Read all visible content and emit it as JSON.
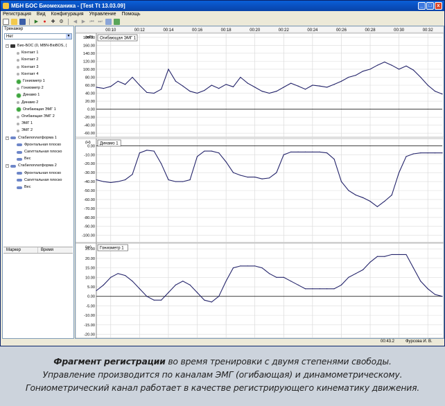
{
  "window": {
    "title": "МБН БОС Биомеханика - [Test Tt  13.03.09]",
    "minimize": "_",
    "maximize": "□",
    "close": "x"
  },
  "menu": [
    "Регистрация",
    "Вид",
    "Конфигурация",
    "Управление",
    "Помощь"
  ],
  "left_panel": {
    "label": "Тренажер",
    "select_value": "Нет",
    "tree": [
      {
        "label": "Био-БОС (0, MBN-BioBOS, (",
        "icon": "device-icon",
        "level": 1,
        "expand": "-"
      },
      {
        "label": "Контакт 1",
        "icon": "channel-inactive-icon",
        "level": 2
      },
      {
        "label": "Контакт 2",
        "icon": "channel-inactive-icon",
        "level": 2
      },
      {
        "label": "Контакт 3",
        "icon": "channel-inactive-icon",
        "level": 2
      },
      {
        "label": "Контакт 4",
        "icon": "channel-inactive-icon",
        "level": 2
      },
      {
        "label": "Гониометр 1",
        "icon": "channel-active-icon",
        "level": 2
      },
      {
        "label": "Гониометр 2",
        "icon": "channel-inactive-icon",
        "level": 2
      },
      {
        "label": "Динамо 1",
        "icon": "channel-active-icon",
        "level": 2
      },
      {
        "label": "Динамо 2",
        "icon": "channel-inactive-icon",
        "level": 2
      },
      {
        "label": "Огибающая ЭМГ 1",
        "icon": "channel-active-icon",
        "level": 2
      },
      {
        "label": "Огибающая ЭМГ 2",
        "icon": "channel-inactive-icon",
        "level": 2
      },
      {
        "label": "ЭМГ 1",
        "icon": "channel-inactive-icon",
        "level": 2
      },
      {
        "label": "ЭМГ 2",
        "icon": "channel-inactive-icon",
        "level": 2
      },
      {
        "label": "Стабилоплатформа 1",
        "icon": "platform-icon",
        "level": 1,
        "expand": "-"
      },
      {
        "label": "Фронтальная плоско",
        "icon": "platform-icon",
        "level": 2
      },
      {
        "label": "Сагиттальная плоско",
        "icon": "platform-icon",
        "level": 2
      },
      {
        "label": "Вес",
        "icon": "platform-icon",
        "level": 2
      },
      {
        "label": "Стабилоплатформа 2",
        "icon": "platform-icon",
        "level": 1,
        "expand": "-"
      },
      {
        "label": "Фронтальная плоско",
        "icon": "platform-icon",
        "level": 2
      },
      {
        "label": "Сагиттальная плоско",
        "icon": "platform-icon",
        "level": 2
      },
      {
        "label": "Вес",
        "icon": "platform-icon",
        "level": 2
      }
    ],
    "grid_columns": [
      "Маркер",
      "Время"
    ]
  },
  "time_axis": [
    "00:10",
    "00:12",
    "00:14",
    "00:16",
    "00:18",
    "00:20",
    "00:22",
    "00:24",
    "00:26",
    "00:28",
    "00:30",
    "00:32"
  ],
  "chart_data": [
    {
      "type": "line",
      "title": "Огибающая ЭМГ 1",
      "unit": "(мВ)",
      "ylim": [
        -70,
        190
      ],
      "yticks": [
        "180.00",
        "160.00",
        "140.00",
        "120.00",
        "100.00",
        "80.00",
        "60.00",
        "40.00",
        "20.00",
        "0.00",
        "-20.00",
        "-40.00",
        "-60.00"
      ],
      "x": [
        9.0,
        9.5,
        10.0,
        10.5,
        11.0,
        11.5,
        12.0,
        12.5,
        13.0,
        13.5,
        14.0,
        14.5,
        15.0,
        15.5,
        16.0,
        16.5,
        17.0,
        17.5,
        18.0,
        18.5,
        19.0,
        19.5,
        20.0,
        20.5,
        21.0,
        21.5,
        22.0,
        22.5,
        23.0,
        23.5,
        24.0,
        24.5,
        25.0,
        25.5,
        26.0,
        26.5,
        27.0,
        27.5,
        28.0,
        28.5,
        29.0,
        29.5,
        30.0,
        30.5,
        31.0,
        31.5,
        32.0,
        32.5,
        33.0
      ],
      "values": [
        55,
        52,
        57,
        70,
        62,
        80,
        60,
        42,
        40,
        50,
        100,
        70,
        58,
        45,
        40,
        47,
        60,
        52,
        62,
        56,
        80,
        65,
        55,
        45,
        40,
        45,
        55,
        65,
        58,
        50,
        60,
        58,
        55,
        62,
        70,
        80,
        85,
        95,
        100,
        110,
        118,
        110,
        100,
        108,
        98,
        80,
        60,
        45,
        38
      ]
    },
    {
      "type": "line",
      "title": "Динамо 1",
      "unit": "(Н)",
      "ylim": [
        -108,
        8
      ],
      "yticks": [
        "0.00",
        "-10.00",
        "-20.00",
        "-30.00",
        "-40.00",
        "-50.00",
        "-60.00",
        "-70.00",
        "-80.00",
        "-90.00",
        "-100.00"
      ],
      "x": [
        9.0,
        9.5,
        10.0,
        10.5,
        11.0,
        11.5,
        12.0,
        12.5,
        13.0,
        13.5,
        14.0,
        14.5,
        15.0,
        15.5,
        16.0,
        16.5,
        17.0,
        17.5,
        18.0,
        18.5,
        19.0,
        19.5,
        20.0,
        20.5,
        21.0,
        21.5,
        22.0,
        22.5,
        23.0,
        23.5,
        24.0,
        24.5,
        25.0,
        25.5,
        26.0,
        26.5,
        27.0,
        27.5,
        28.0,
        28.5,
        29.0,
        29.5,
        30.0,
        30.5,
        31.0,
        31.5,
        32.0,
        32.5,
        33.0
      ],
      "values": [
        -38,
        -40,
        -41,
        -40,
        -38,
        -32,
        -8,
        -5,
        -6,
        -20,
        -38,
        -40,
        -40,
        -38,
        -12,
        -6,
        -6,
        -8,
        -18,
        -30,
        -33,
        -35,
        -35,
        -37,
        -36,
        -30,
        -10,
        -7,
        -7,
        -7,
        -7,
        -7,
        -8,
        -15,
        -40,
        -50,
        -55,
        -58,
        -62,
        -68,
        -62,
        -55,
        -30,
        -12,
        -9,
        -8,
        -8,
        -8,
        -8
      ]
    },
    {
      "type": "line",
      "title": "Гониометр 1",
      "unit": "(гр)",
      "ylim": [
        -22,
        28
      ],
      "yticks": [
        "25.00",
        "20.00",
        "15.00",
        "10.00",
        "5.00",
        "0.00",
        "-5.00",
        "-10.00",
        "-15.00",
        "-20.00"
      ],
      "x": [
        9.0,
        9.5,
        10.0,
        10.5,
        11.0,
        11.5,
        12.0,
        12.5,
        13.0,
        13.5,
        14.0,
        14.5,
        15.0,
        15.5,
        16.0,
        16.5,
        17.0,
        17.5,
        18.0,
        18.5,
        19.0,
        19.5,
        20.0,
        20.5,
        21.0,
        21.5,
        22.0,
        22.5,
        23.0,
        23.5,
        24.0,
        24.5,
        25.0,
        25.5,
        26.0,
        26.5,
        27.0,
        27.5,
        28.0,
        28.5,
        29.0,
        29.5,
        30.0,
        30.5,
        31.0,
        31.5,
        32.0,
        32.5,
        33.0
      ],
      "values": [
        3,
        6,
        10,
        12,
        11,
        8,
        4,
        0,
        -2,
        -2,
        2,
        6,
        8,
        6,
        2,
        -2,
        -3,
        0,
        8,
        15,
        16,
        16,
        16,
        15,
        12,
        10,
        10,
        8,
        6,
        4,
        4,
        4,
        4,
        4,
        6,
        10,
        12,
        14,
        18,
        21,
        21,
        22,
        22,
        22,
        15,
        8,
        4,
        1,
        0
      ]
    }
  ],
  "status": {
    "time": "00:43.2",
    "user": "Фурсова И. В."
  },
  "caption": {
    "bold": "Фрагмент регистрации",
    "line1": " во время тренировки с двумя степенями свободы.",
    "line2": "Управление производится по каналам ЭМГ (огибающая) и динамометрическому.",
    "line3": "Гониометрический канал работает в качестве регистрирующего кинематику движения."
  }
}
